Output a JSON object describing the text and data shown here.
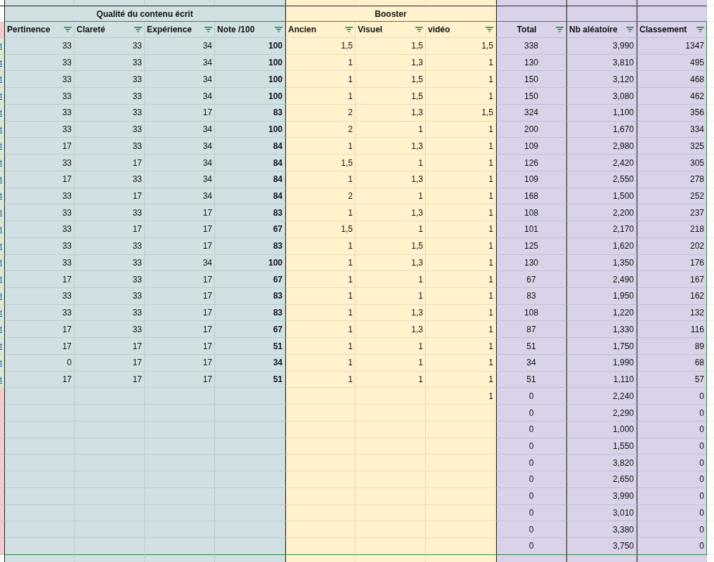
{
  "groups": [
    {
      "title": "Qualité du contenu écrit",
      "color": "#d0e0e3",
      "kind": "merged",
      "columns": [
        {
          "label": "Pertinence",
          "bold": false
        },
        {
          "label": "Clareté",
          "bold": false
        },
        {
          "label": "Expérience",
          "bold": false
        },
        {
          "label": "Note /100",
          "bold": true
        }
      ]
    },
    {
      "title": "Booster",
      "color": "#fff2cc",
      "kind": "merged",
      "columns": [
        {
          "label": "Ancien",
          "bold": false
        },
        {
          "label": "Visuel",
          "bold": false
        },
        {
          "label": "vidéo",
          "bold": false
        }
      ]
    },
    {
      "color": "#d9d2e9",
      "kind": "separate",
      "columns": [
        {
          "label": "Total",
          "bold": false
        },
        {
          "label": "Nb aléatoire",
          "bold": false
        },
        {
          "label": "Classement",
          "bold": false
        }
      ]
    }
  ],
  "rows": [
    {
      "link": "t",
      "cells": [
        "33",
        "33",
        "34",
        "100",
        "1,5",
        "1,5",
        "1,5",
        "338",
        "3,990",
        "1347"
      ]
    },
    {
      "link": "t",
      "cells": [
        "33",
        "33",
        "34",
        "100",
        "1",
        "1,3",
        "1",
        "130",
        "3,810",
        "495"
      ]
    },
    {
      "link": "t",
      "cells": [
        "33",
        "33",
        "34",
        "100",
        "1",
        "1,5",
        "1",
        "150",
        "3,120",
        "468"
      ]
    },
    {
      "link": "t",
      "cells": [
        "33",
        "33",
        "34",
        "100",
        "1",
        "1,5",
        "1",
        "150",
        "3,080",
        "462"
      ]
    },
    {
      "link": "t",
      "cells": [
        "33",
        "33",
        "17",
        "83",
        "2",
        "1,3",
        "1,5",
        "324",
        "1,100",
        "356"
      ]
    },
    {
      "link": "t",
      "cells": [
        "33",
        "33",
        "34",
        "100",
        "2",
        "1",
        "1",
        "200",
        "1,670",
        "334"
      ]
    },
    {
      "link": "t",
      "cells": [
        "17",
        "33",
        "34",
        "84",
        "1",
        "1,3",
        "1",
        "109",
        "2,980",
        "325"
      ]
    },
    {
      "link": "t",
      "cells": [
        "33",
        "17",
        "34",
        "84",
        "1,5",
        "1",
        "1",
        "126",
        "2,420",
        "305"
      ]
    },
    {
      "link": "t",
      "cells": [
        "17",
        "33",
        "34",
        "84",
        "1",
        "1,3",
        "1",
        "109",
        "2,550",
        "278"
      ]
    },
    {
      "link": "t",
      "cells": [
        "33",
        "17",
        "34",
        "84",
        "2",
        "1",
        "1",
        "168",
        "1,500",
        "252"
      ]
    },
    {
      "link": "t",
      "cells": [
        "33",
        "33",
        "17",
        "83",
        "1",
        "1,3",
        "1",
        "108",
        "2,200",
        "237"
      ]
    },
    {
      "link": "t",
      "cells": [
        "33",
        "17",
        "17",
        "67",
        "1,5",
        "1",
        "1",
        "101",
        "2,170",
        "218"
      ]
    },
    {
      "link": "t",
      "cells": [
        "33",
        "33",
        "17",
        "83",
        "1",
        "1,5",
        "1",
        "125",
        "1,620",
        "202"
      ]
    },
    {
      "link": "t",
      "cells": [
        "33",
        "33",
        "34",
        "100",
        "1",
        "1,3",
        "1",
        "130",
        "1,350",
        "176"
      ]
    },
    {
      "link": "t",
      "cells": [
        "17",
        "33",
        "17",
        "67",
        "1",
        "1",
        "1",
        "67",
        "2,490",
        "167"
      ]
    },
    {
      "link": "t",
      "cells": [
        "33",
        "33",
        "17",
        "83",
        "1",
        "1",
        "1",
        "83",
        "1,950",
        "162"
      ]
    },
    {
      "link": "t",
      "cells": [
        "33",
        "33",
        "17",
        "83",
        "1",
        "1,3",
        "1",
        "108",
        "1,220",
        "132"
      ]
    },
    {
      "link": "t",
      "cells": [
        "17",
        "33",
        "17",
        "67",
        "1",
        "1,3",
        "1",
        "87",
        "1,330",
        "116"
      ]
    },
    {
      "link": "t",
      "cells": [
        "17",
        "17",
        "17",
        "51",
        "1",
        "1",
        "1",
        "51",
        "1,750",
        "89"
      ]
    },
    {
      "link": "t",
      "cells": [
        "0",
        "17",
        "17",
        "34",
        "1",
        "1",
        "1",
        "34",
        "1,990",
        "68"
      ]
    },
    {
      "link": "t",
      "cells": [
        "17",
        "17",
        "17",
        "51",
        "1",
        "1",
        "1",
        "51",
        "1,110",
        "57"
      ]
    },
    {
      "cells": [
        null,
        null,
        null,
        null,
        null,
        null,
        "1",
        "0",
        "2,240",
        "0"
      ]
    },
    {
      "cells": [
        null,
        null,
        null,
        null,
        null,
        null,
        null,
        "0",
        "2,290",
        "0"
      ]
    },
    {
      "cells": [
        null,
        null,
        null,
        null,
        null,
        null,
        null,
        "0",
        "1,000",
        "0"
      ]
    },
    {
      "cells": [
        null,
        null,
        null,
        null,
        null,
        null,
        null,
        "0",
        "1,550",
        "0"
      ]
    },
    {
      "cells": [
        null,
        null,
        null,
        null,
        null,
        null,
        null,
        "0",
        "3,820",
        "0"
      ]
    },
    {
      "cells": [
        null,
        null,
        null,
        null,
        null,
        null,
        null,
        "0",
        "2,650",
        "0"
      ]
    },
    {
      "cells": [
        null,
        null,
        null,
        null,
        null,
        null,
        null,
        "0",
        "3,990",
        "0"
      ]
    },
    {
      "cells": [
        null,
        null,
        null,
        null,
        null,
        null,
        null,
        "0",
        "3,010",
        "0"
      ]
    },
    {
      "cells": [
        null,
        null,
        null,
        null,
        null,
        null,
        null,
        "0",
        "3,380",
        "0"
      ]
    },
    {
      "cells": [
        null,
        null,
        null,
        null,
        null,
        null,
        null,
        "0",
        "3,750",
        "0"
      ]
    }
  ]
}
